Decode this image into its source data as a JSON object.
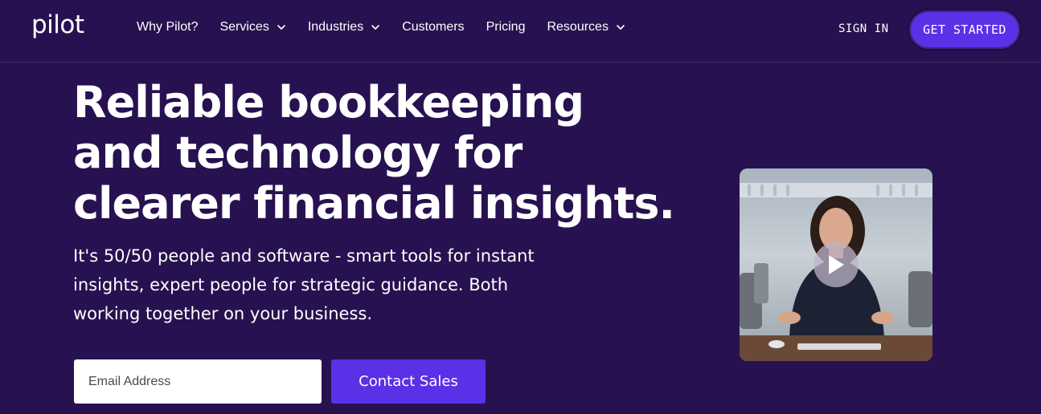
{
  "brand": {
    "logo_text": "pilot",
    "accent": "#5b30e6",
    "background": "#281150"
  },
  "nav": {
    "items": [
      {
        "label": "Why Pilot?",
        "has_dropdown": false
      },
      {
        "label": "Services",
        "has_dropdown": true
      },
      {
        "label": "Industries",
        "has_dropdown": true
      },
      {
        "label": "Customers",
        "has_dropdown": false
      },
      {
        "label": "Pricing",
        "has_dropdown": false
      },
      {
        "label": "Resources",
        "has_dropdown": true
      }
    ],
    "sign_in": "SIGN IN",
    "get_started": "GET STARTED"
  },
  "hero": {
    "headline_lines": [
      "Reliable bookkeeping",
      "and technology for",
      "clearer financial insights."
    ],
    "subtext_lines": [
      "It's 50/50 people and software - smart tools for instant",
      "insights, expert people for strategic guidance. Both",
      "working together on your business."
    ],
    "email_placeholder": "Email Address",
    "cta_label": "Contact Sales"
  },
  "video": {
    "icon": "play-icon"
  }
}
